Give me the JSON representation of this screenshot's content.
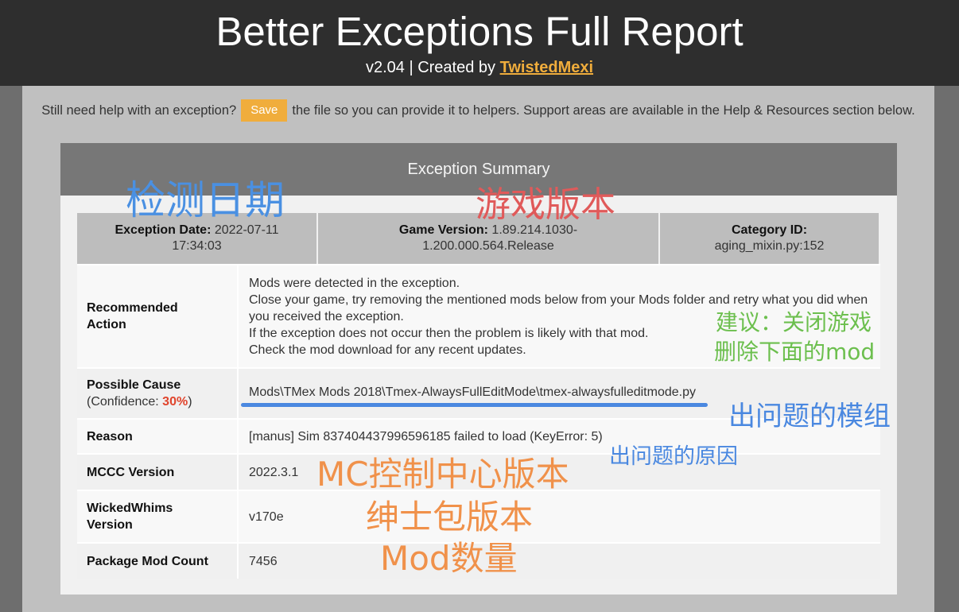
{
  "header": {
    "title": "Better Exceptions Full Report",
    "version_prefix": "v2.04 | Created by ",
    "author": "TwistedMexi"
  },
  "notice": {
    "before": "Still need help with an exception?",
    "save_label": "Save",
    "after": "the file so you can provide it to helpers. Support areas are available in the Help & Resources section below."
  },
  "summary": {
    "title": "Exception Summary",
    "exception_date_label": "Exception Date:",
    "exception_date_value": "2022-07-11 17:34:03",
    "game_version_label": "Game Version:",
    "game_version_value": "1.89.214.1030-1.200.000.564.Release",
    "category_id_label": "Category ID:",
    "category_id_value": "aging_mixin.py:152"
  },
  "details": {
    "recommended_action": {
      "label": "Recommended Action",
      "lines": [
        "Mods were detected in the exception.",
        "Close your game, try removing the mentioned mods below from your Mods folder and retry what you did when you received the exception.",
        "If the exception does not occur then the problem is likely with that mod.",
        "Check the mod download for any recent updates."
      ]
    },
    "possible_cause": {
      "label": "Possible Cause",
      "confidence_prefix": "(Confidence: ",
      "confidence_value": "30%",
      "confidence_suffix": ")",
      "value": "Mods\\TMex Mods 2018\\Tmex-AlwaysFullEditMode\\tmex-alwaysfulleditmode.py"
    },
    "reason": {
      "label": "Reason",
      "value": "[manus] Sim 837404437996596185 failed to load (KeyError: 5)"
    },
    "mccc_version": {
      "label": "MCCC Version",
      "value": "2022.3.1"
    },
    "wickedwhims_version": {
      "label": "WickedWhims Version",
      "value": "v170e"
    },
    "package_mod_count": {
      "label": "Package Mod Count",
      "value": "7456"
    }
  },
  "annotations": {
    "date": {
      "text": "检测日期",
      "color": "#4a90e2"
    },
    "game_version": {
      "text": "游戏版本",
      "color": "#e05a5a"
    },
    "suggestion_line1": {
      "text": "建议：关闭游戏",
      "color": "#6cbf4e"
    },
    "suggestion_line2": {
      "text": "删除下面的mod",
      "color": "#6cbf4e"
    },
    "problem_mod": {
      "text": "出问题的模组",
      "color": "#4a88e0"
    },
    "problem_reason": {
      "text": "出问题的原因",
      "color": "#4a88e0"
    },
    "mccc": {
      "text": "MC控制中心版本",
      "color": "#f0914a"
    },
    "wickedwhims": {
      "text": "绅士包版本",
      "color": "#f0914a"
    },
    "mod_count": {
      "text": "Mod数量",
      "color": "#f0914a"
    }
  },
  "colors": {
    "accent": "#f0ad3c",
    "confidence": "#e0442c",
    "header_bg": "#2e2e2e",
    "card_header_bg": "#777777"
  }
}
